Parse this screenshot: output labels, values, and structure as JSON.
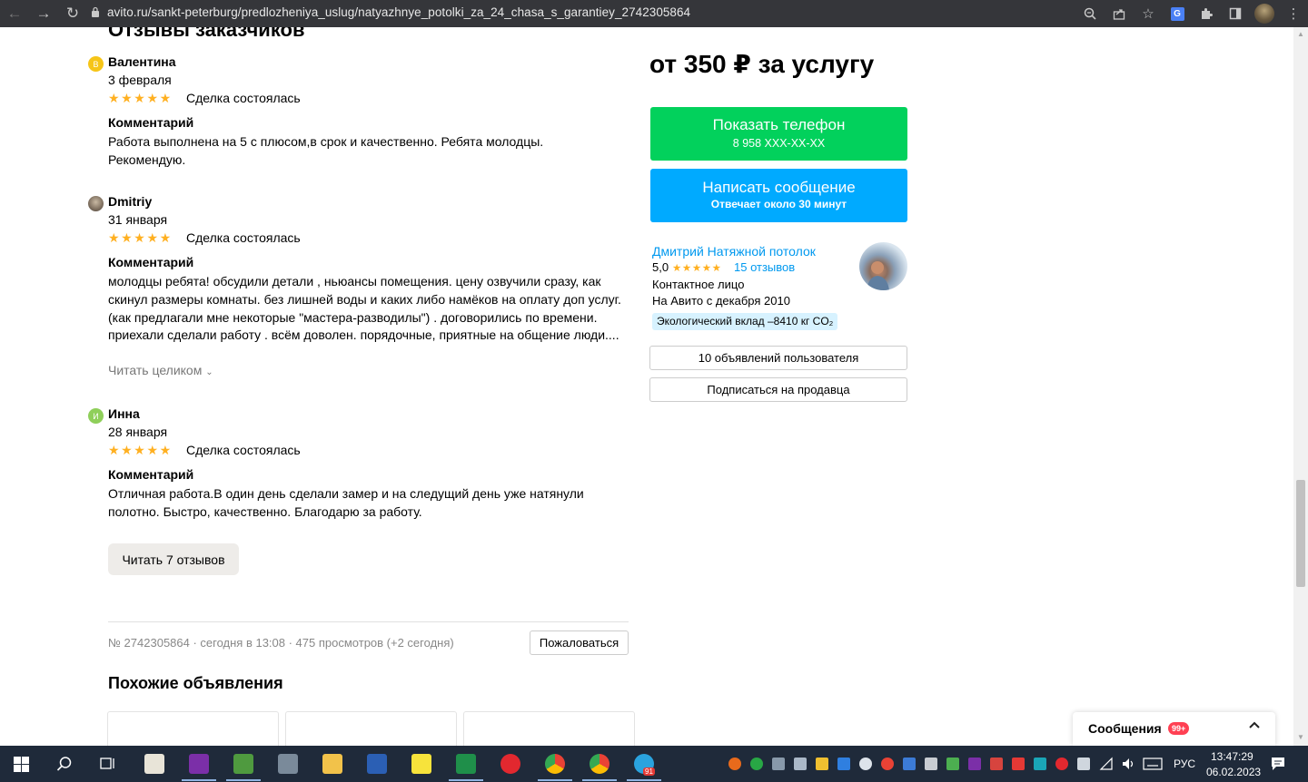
{
  "browser": {
    "url": "avito.ru/sankt-peterburg/predlozheniya_uslug/natyazhnye_potolki_za_24_chasa_s_garantiey_2742305864"
  },
  "reviews_section": {
    "title": "Отзывы заказчиков",
    "comment_label": "Комментарий",
    "read_more": "Читать целиком",
    "read_all_button": "Читать 7 отзывов",
    "items": [
      {
        "avatar_letter": "В",
        "avatar_color": "#f6c518",
        "name": "Валентина",
        "date": "3 февраля",
        "stars": "★★★★★",
        "deal": "Сделка состоялась",
        "text": "Работа выполнена на 5 с плюсом,в срок и качественно. Ребята молодцы. Рекомендую."
      },
      {
        "avatar_letter": "",
        "avatar_color": "#8a7d6c",
        "name": "Dmitriy",
        "date": "31 января",
        "stars": "★★★★★",
        "deal": "Сделка состоялась",
        "text": "молодцы ребята! обсудили детали , ньюансы помещения. цену озвучили сразу, как скинул размеры комнаты. без лишней воды и каких либо намёков на оплату доп услуг. (как предлагали мне некоторые \"мастера-разводилы\") . договорились по времени. приехали сделали работу . всём доволен. порядочные, приятные на общение люди...."
      },
      {
        "avatar_letter": "И",
        "avatar_color": "#8fcf5a",
        "name": "Инна",
        "date": "28 января",
        "stars": "★★★★★",
        "deal": "Сделка состоялась",
        "text": "Отличная работа.В один день сделали замер и на следущий день уже натянули полотно. Быстро, качественно. Благодарю за работу."
      }
    ]
  },
  "listing_meta": {
    "info": "№ 2742305864 · сегодня в 13:08 · 475 просмотров (+2 сегодня)",
    "complain_button": "Пожаловаться"
  },
  "similar": {
    "title": "Похожие объявления"
  },
  "sidebar": {
    "price": "от 350 ₽ за услугу",
    "phone_button": {
      "label": "Показать телефон",
      "sub": "8 958 XXX-XX-XX"
    },
    "message_button": {
      "label": "Написать сообщение",
      "sub": "Отвечает около 30 минут"
    },
    "seller": {
      "name": "Дмитрий Натяжной потолок",
      "rating": "5,0",
      "stars": "★★★★★",
      "reviews": "15 отзывов",
      "role": "Контактное лицо",
      "since": "На Авито с декабря 2010",
      "eco": "Экологический вклад –8410 кг CO₂"
    },
    "ads_button": "10 объявлений пользователя",
    "subscribe_button": "Подписаться на продавца"
  },
  "messages_widget": {
    "label": "Сообщения",
    "badge": "99+"
  },
  "taskbar": {
    "lang": "РУС",
    "time": "13:47:29",
    "date": "06.02.2023",
    "telegram_badge": "91"
  },
  "colors": {
    "phone_green": "#02d15c",
    "message_blue": "#00aaff",
    "link_blue": "#0099ef",
    "star_yellow": "#ffb021"
  }
}
